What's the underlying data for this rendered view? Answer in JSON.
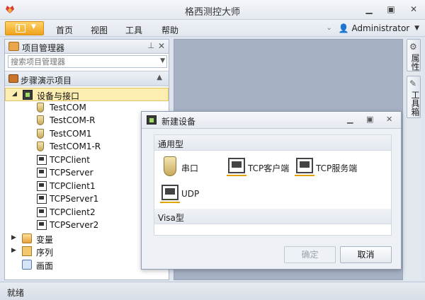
{
  "window": {
    "title": "格西测控大师"
  },
  "menu": {
    "items": [
      "首页",
      "视图",
      "工具",
      "帮助"
    ],
    "user": "Administrator"
  },
  "left_panel": {
    "title": "项目管理器",
    "search_placeholder": "搜索项目管理器",
    "project": "步骤演示项目",
    "tree": {
      "devices_label": "设备与接口",
      "devices": [
        "TestCOM",
        "TestCOM-R",
        "TestCOM1",
        "TestCOM1-R",
        "TCPClient",
        "TCPServer",
        "TCPClient1",
        "TCPServer1",
        "TCPClient2",
        "TCPServer2"
      ],
      "variables_label": "变量",
      "sequence_label": "序列",
      "screen_label": "画面"
    }
  },
  "right_strip": {
    "properties_label": "属性",
    "toolbox_label": "工具箱"
  },
  "dialog": {
    "title": "新建设备",
    "general_group": "通用型",
    "visa_group": "Visa型",
    "items": {
      "serial": "串口",
      "tcp_client": "TCP客户端",
      "tcp_server": "TCP服务端",
      "udp": "UDP"
    },
    "ok": "确定",
    "cancel": "取消"
  },
  "status": {
    "text": "就绪"
  },
  "colors": {
    "accent": "#f0a21b",
    "selection": "#fdedb0",
    "workspace": "#a6b2c4"
  }
}
